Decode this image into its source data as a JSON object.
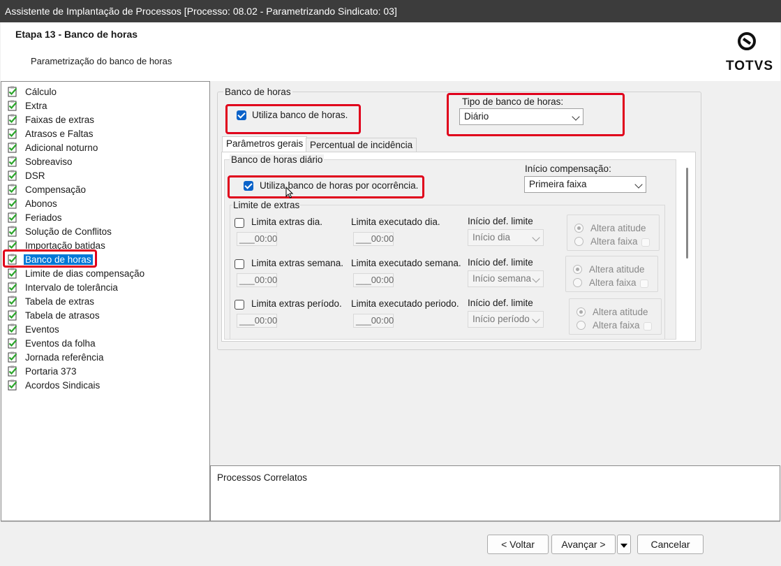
{
  "window": {
    "title": "Assistente de Implantação de Processos [Processo: 08.02 - Parametrizando Sindicato: 03]"
  },
  "header": {
    "step_title": "Etapa 13 - Banco de horas",
    "step_subtitle": "Parametrização do banco de horas",
    "logo_text": "TOTVS"
  },
  "sidebar": {
    "items": [
      {
        "label": "Cálculo"
      },
      {
        "label": "Extra"
      },
      {
        "label": "Faixas de extras"
      },
      {
        "label": "Atrasos e Faltas"
      },
      {
        "label": "Adicional noturno"
      },
      {
        "label": "Sobreaviso"
      },
      {
        "label": "DSR"
      },
      {
        "label": "Compensação"
      },
      {
        "label": "Abonos"
      },
      {
        "label": "Feriados"
      },
      {
        "label": "Solução de Conflitos"
      },
      {
        "label": "Importação batidas"
      },
      {
        "label": "Banco de horas",
        "selected": true
      },
      {
        "label": "Limite de dias compensação"
      },
      {
        "label": "Intervalo de tolerância"
      },
      {
        "label": "Tabela de extras"
      },
      {
        "label": "Tabela de atrasos"
      },
      {
        "label": "Eventos"
      },
      {
        "label": "Eventos da folha"
      },
      {
        "label": "Jornada referência"
      },
      {
        "label": "Portaria 373"
      },
      {
        "label": "Acordos Sindicais"
      }
    ]
  },
  "banco": {
    "group_label": "Banco de horas",
    "utiliza_label": "Utiliza banco de horas.",
    "utiliza_checked": true,
    "tipo_label": "Tipo de banco de horas:",
    "tipo_value": "Diário"
  },
  "tabs": [
    {
      "label": "Parâmetros gerais",
      "active": true
    },
    {
      "label": "Percentual de incidência",
      "active": false
    }
  ],
  "diario": {
    "group_label": "Banco de horas diário",
    "ocorrencia_label": "Utiliza banco de horas por ocorrência.",
    "ocorrencia_checked": true,
    "inicio_comp_label": "Início compensação:",
    "inicio_comp_value": "Primeira faixa",
    "limite_label": "Limite de extras",
    "rows": [
      {
        "check_label": "Limita extras dia.",
        "exec_label": "Limita executado dia.",
        "inicio_label": "Início def. limite",
        "time1": "___00:00",
        "time2": "___00:00",
        "inicio_value": "Início dia",
        "radio1": "Altera atitude",
        "radio2": "Altera faixa"
      },
      {
        "check_label": "Limita extras semana.",
        "exec_label": "Limita executado semana.",
        "inicio_label": "Início def. limite",
        "time1": "___00:00",
        "time2": "___00:00",
        "inicio_value": "Início semana",
        "radio1": "Altera atitude",
        "radio2": "Altera faixa"
      },
      {
        "check_label": "Limita extras período.",
        "exec_label": "Limita executado periodo.",
        "inicio_label": "Início def. limite",
        "time1": "___00:00",
        "time2": "___00:00",
        "inicio_value": "Início período",
        "radio1": "Altera atitude",
        "radio2": "Altera faixa"
      }
    ]
  },
  "related": {
    "label": "Processos Correlatos"
  },
  "footer": {
    "back": "< Voltar",
    "next": "Avançar >",
    "cancel": "Cancelar"
  },
  "colors": {
    "accent": "#0078d7",
    "highlight": "#e0001b",
    "titlebar": "#3c3c3c"
  }
}
